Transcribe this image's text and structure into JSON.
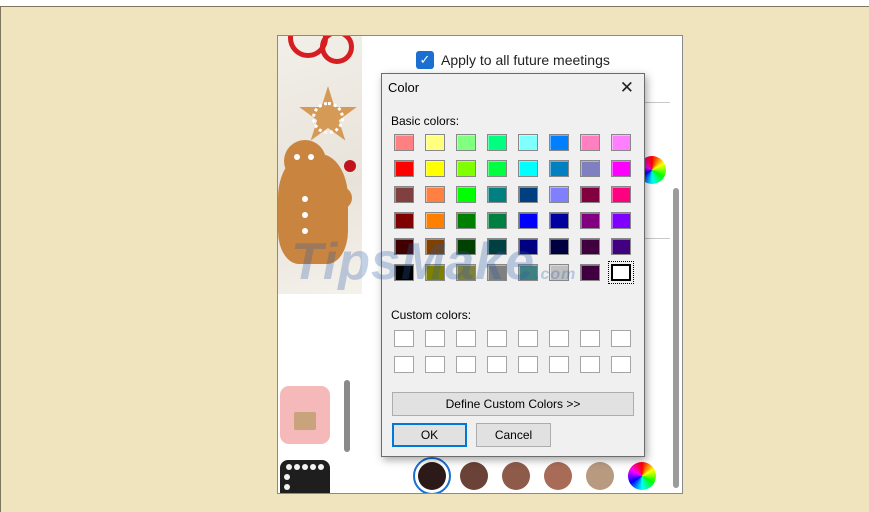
{
  "background_settings": {
    "apply_future_label": "Apply to all future meetings",
    "apply_future_checked": true
  },
  "color_dialog": {
    "title": "Color",
    "close_glyph": "✕",
    "basic_colors_label": "Basic colors:",
    "custom_colors_label": "Custom colors:",
    "define_custom_label": "Define Custom Colors >>",
    "ok_label": "OK",
    "cancel_label": "Cancel",
    "selected_basic": "#ffffff",
    "basic_colors": [
      [
        "#ff8080",
        "#ffff80",
        "#80ff80",
        "#00ff80",
        "#80ffff",
        "#0080ff",
        "#ff80c0",
        "#ff80ff"
      ],
      [
        "#ff0000",
        "#ffff00",
        "#80ff00",
        "#00ff40",
        "#00ffff",
        "#0080c0",
        "#8080c0",
        "#ff00ff"
      ],
      [
        "#804040",
        "#ff8040",
        "#00ff00",
        "#008080",
        "#004080",
        "#8080ff",
        "#800040",
        "#ff0080"
      ],
      [
        "#800000",
        "#ff8000",
        "#008000",
        "#008040",
        "#0000ff",
        "#0000a0",
        "#800080",
        "#8000ff"
      ],
      [
        "#400000",
        "#804000",
        "#004000",
        "#004040",
        "#000080",
        "#000040",
        "#400040",
        "#400080"
      ],
      [
        "#000000",
        "#808000",
        "#808040",
        "#808080",
        "#408080",
        "#c0c0c0",
        "#400040",
        "#ffffff"
      ]
    ],
    "custom_colors": [
      [
        "#ffffff",
        "#ffffff",
        "#ffffff",
        "#ffffff",
        "#ffffff",
        "#ffffff",
        "#ffffff",
        "#ffffff"
      ],
      [
        "#ffffff",
        "#ffffff",
        "#ffffff",
        "#ffffff",
        "#ffffff",
        "#ffffff",
        "#ffffff",
        "#ffffff"
      ]
    ]
  },
  "skin_tones": [
    "#2b1a17",
    "#6b4237",
    "#8e5a4a",
    "#a86b57",
    "#b79a80"
  ],
  "watermark": "TipsMake",
  "watermark_suffix": ".com",
  "colors": {
    "page_background": "#efe4be",
    "accent": "#1a6fd0",
    "dialog_background": "#f0f0f0"
  }
}
